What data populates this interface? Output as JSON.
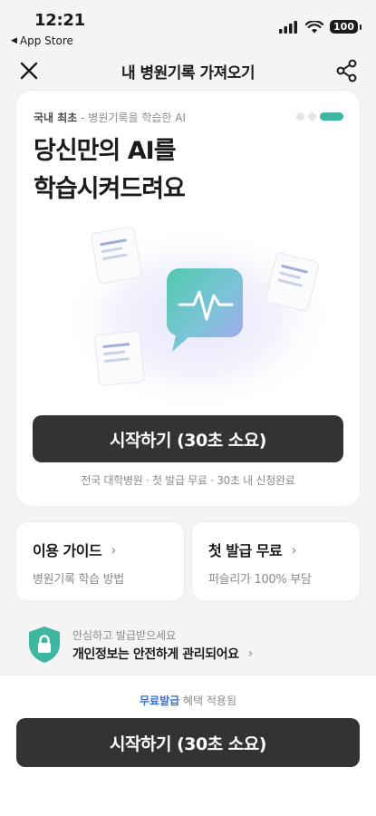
{
  "status_bar": {
    "time": "12:21",
    "back_app": "App Store",
    "battery": "100"
  },
  "header": {
    "title": "내 병원기록 가져오기",
    "close_icon": "close-icon",
    "share_icon": "share-icon"
  },
  "card": {
    "eyebrow_bold": "국내 최초",
    "eyebrow_rest": " - 병원기록을 학습한 AI",
    "headline_line1": "당신만의 AI를",
    "headline_line2": "학습시켜드려요",
    "hero_icon": "ai-pulse-chat-icon",
    "cta_label": "시작하기 (30초 소요)",
    "subnote": "전국 대학병원 · 첫 발급 무료 · 30초 내 신청완료",
    "pager": {
      "count": 3,
      "active": 3
    }
  },
  "guides": [
    {
      "title": "이용 가이드",
      "sub": "병원기록 학습 방법"
    },
    {
      "title": "첫 발급 무료",
      "sub": "퍼슬리가 100% 부담"
    }
  ],
  "safety": {
    "small": "안심하고 발급받으세요",
    "main": "개인정보는 안전하게 관리되어요"
  },
  "bottom": {
    "benefit_highlight": "무료발급",
    "benefit_rest": " 혜택 적용됨",
    "cta_label": "시작하기 (30초 소요)"
  },
  "colors": {
    "accent_teal": "#3fb6a0",
    "dark_button": "#333334",
    "highlight_blue": "#2f6fe8"
  }
}
